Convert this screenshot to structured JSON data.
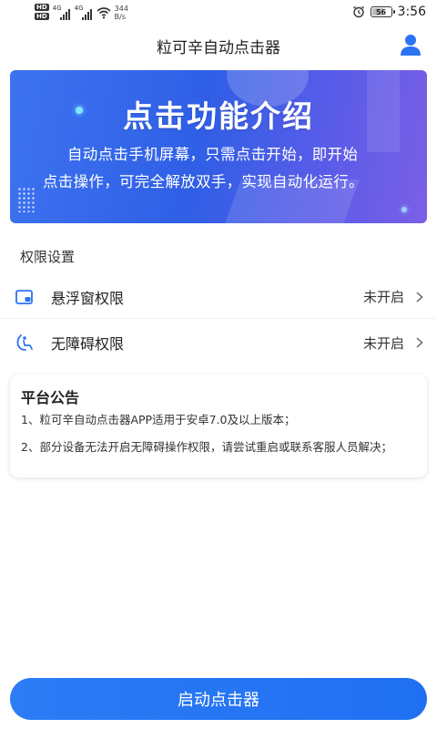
{
  "status_bar": {
    "hd_badges": [
      "HD",
      "HD"
    ],
    "signal_labels": [
      "4G",
      "4G"
    ],
    "net_speed_value": "344",
    "net_speed_unit": "B/s",
    "battery_level": "56",
    "time": "3:56"
  },
  "header": {
    "title": "粒可辛自动点击器",
    "user_icon": "user-icon"
  },
  "banner": {
    "title": "点击功能介绍",
    "desc_line1": "自动点击手机屏幕，只需点击开始，即开始",
    "desc_line2": "点击操作，可完全解放双手，实现自动化运行。"
  },
  "permissions": {
    "section_title": "权限设置",
    "items": [
      {
        "icon": "floating-window-icon",
        "label": "悬浮窗权限",
        "status": "未开启"
      },
      {
        "icon": "accessibility-icon",
        "label": "无障碍权限",
        "status": "未开启"
      }
    ]
  },
  "notice": {
    "title": "平台公告",
    "line1": "1、粒可辛自动点击器APP适用于安卓7.0及以上版本；",
    "line2": "2、部分设备无法开启无障碍操作权限，请尝试重启或联系客服人员解决；"
  },
  "start_button": {
    "label": "启动点击器"
  },
  "colors": {
    "accent": "#1f6ff2",
    "banner_start": "#3d73f0",
    "banner_end": "#7b5fe6"
  }
}
